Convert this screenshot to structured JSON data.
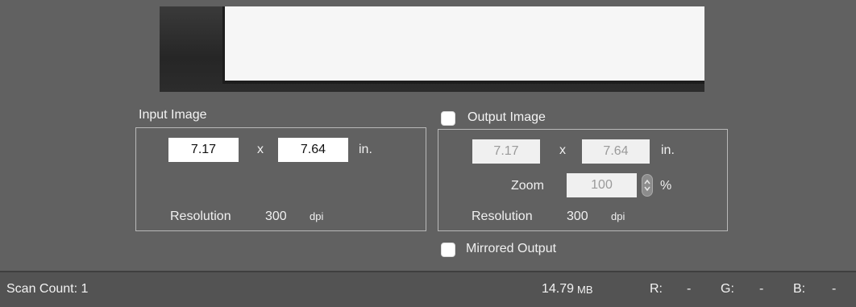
{
  "input_image": {
    "title": "Input Image",
    "width": "7.17",
    "times": "x",
    "height": "7.64",
    "unit": "in.",
    "resolution_label": "Resolution",
    "resolution_value": "300",
    "resolution_unit": "dpi"
  },
  "output_image": {
    "title": "Output Image",
    "checked": false,
    "width": "7.17",
    "times": "x",
    "height": "7.64",
    "unit": "in.",
    "zoom_label": "Zoom",
    "zoom_value": "100",
    "zoom_unit": "%",
    "resolution_label": "Resolution",
    "resolution_value": "300",
    "resolution_unit": "dpi"
  },
  "mirrored_output": {
    "label": "Mirrored Output",
    "checked": false
  },
  "status_bar": {
    "scan_count": "Scan Count: 1",
    "size_value": "14.79",
    "size_unit": "MB",
    "r_label": "R:",
    "r_value": "-",
    "g_label": "G:",
    "g_value": "-",
    "b_label": "B:",
    "b_value": "-"
  }
}
